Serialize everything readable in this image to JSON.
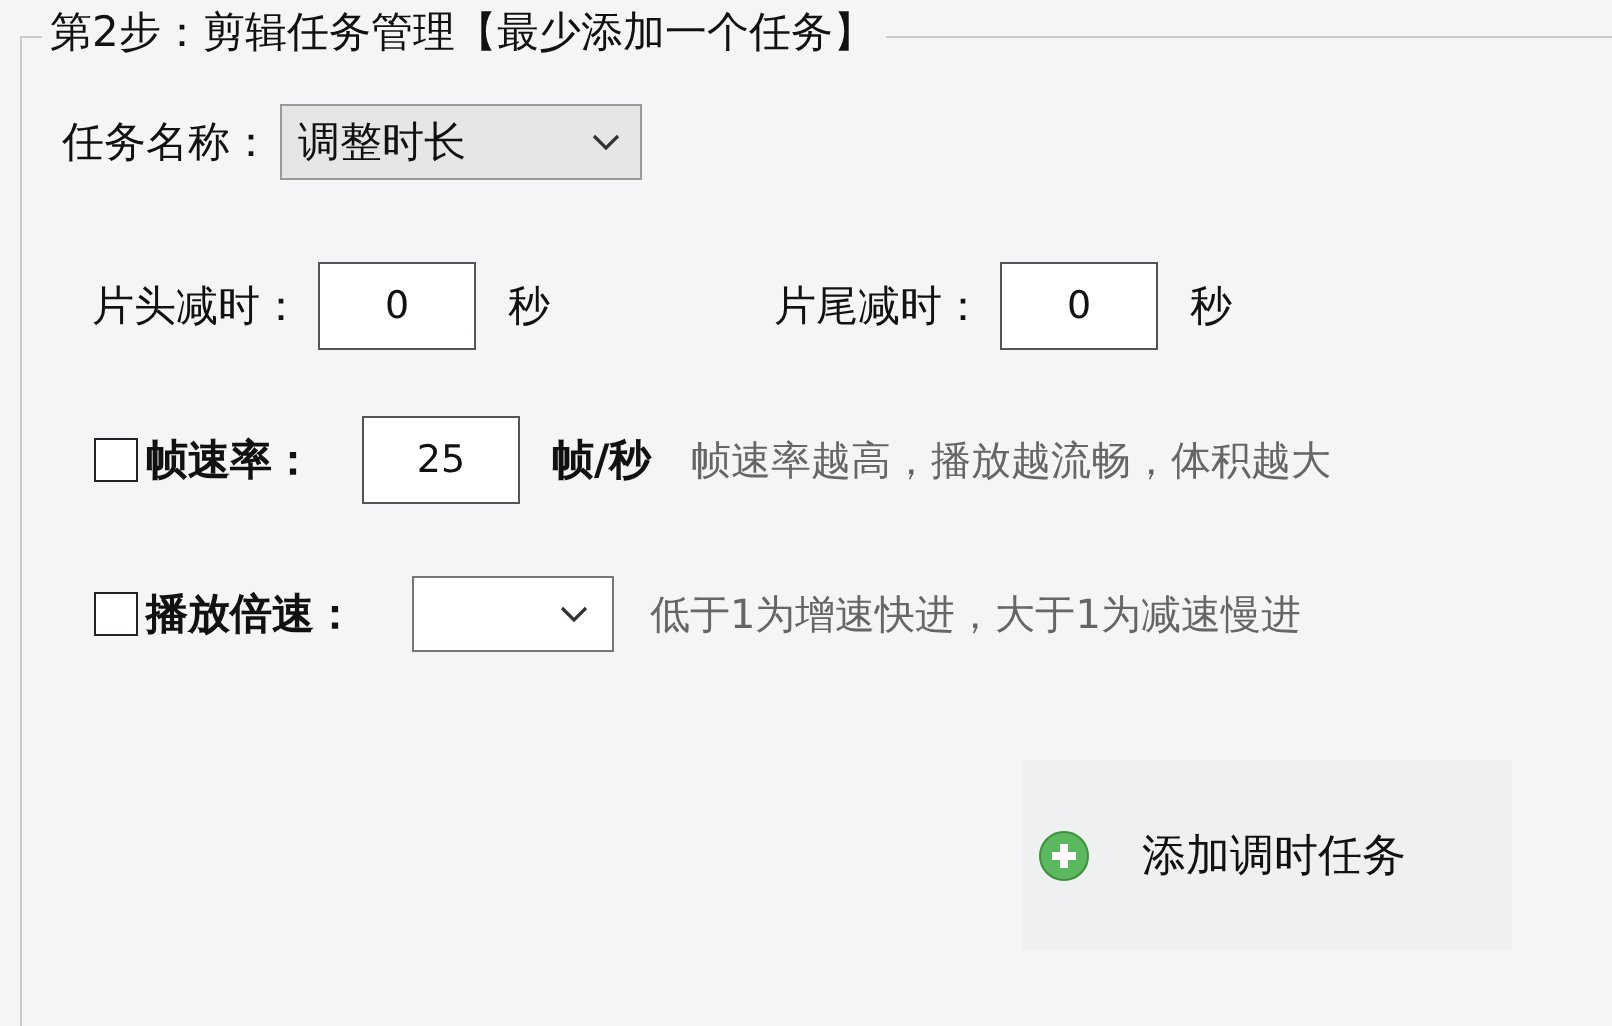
{
  "group": {
    "title": "第2步：剪辑任务管理【最少添加一个任务】"
  },
  "task_name": {
    "label": "任务名称：",
    "value": "调整时长"
  },
  "trim": [
    {
      "label": "片头减时：",
      "value": "0",
      "unit": "秒"
    },
    {
      "label": "片尾减时：",
      "value": "0",
      "unit": "秒"
    }
  ],
  "options": [
    {
      "kind": "input",
      "label": "帧速率：",
      "checked": false,
      "value": "25",
      "unit": "帧/秒",
      "hint": "帧速率越高，播放越流畅，体积越大"
    },
    {
      "kind": "dropdown",
      "label": "播放倍速：",
      "checked": false,
      "hint": "低于1为增速快进，大于1为减速慢进"
    }
  ],
  "add_button": {
    "label": "添加调时任务"
  }
}
